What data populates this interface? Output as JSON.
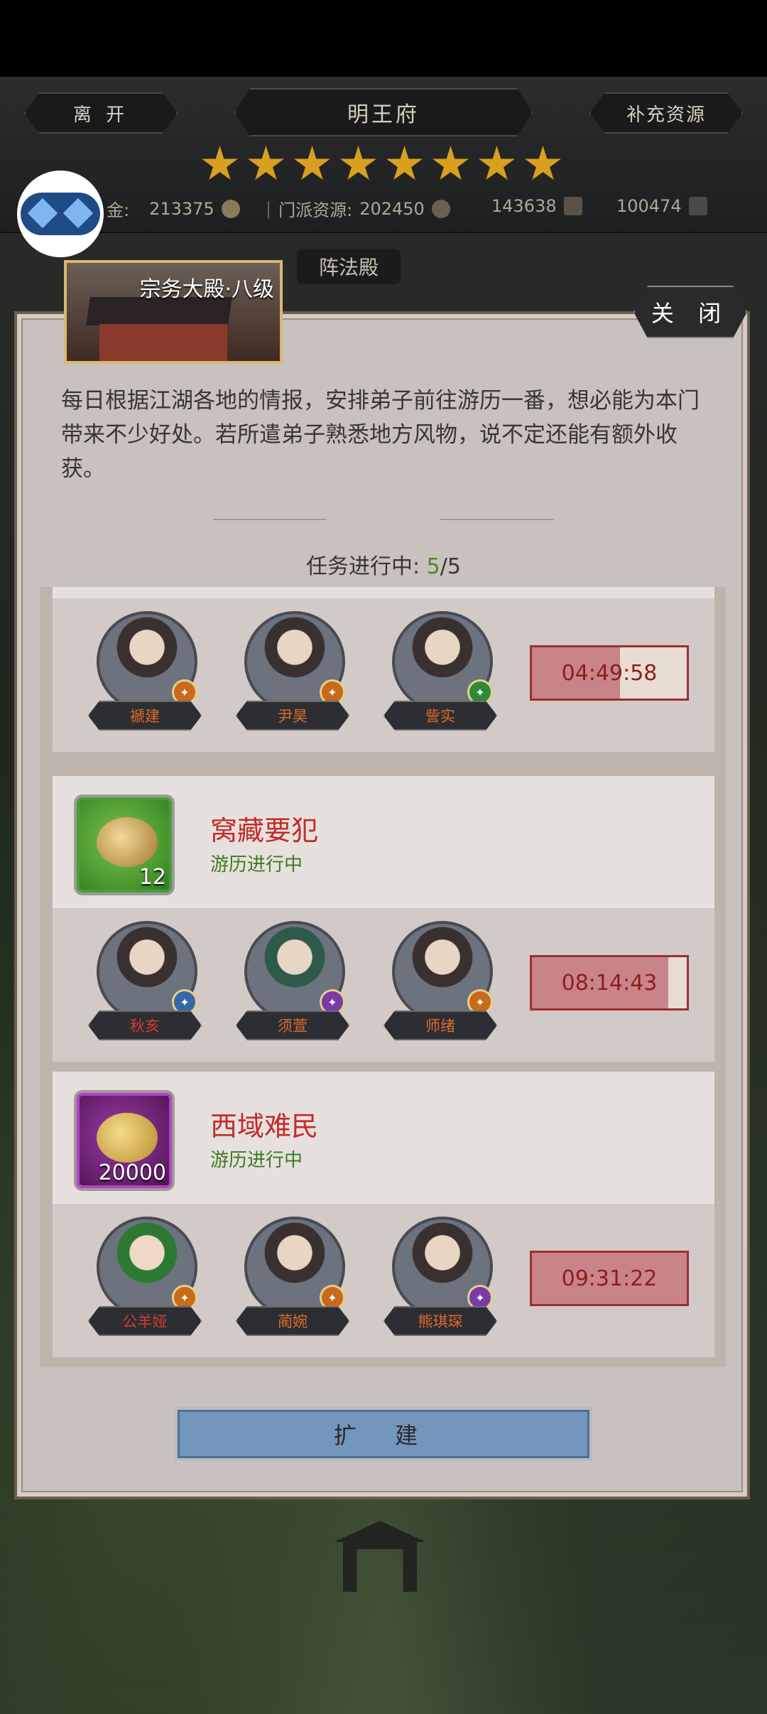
{
  "top_bar": {
    "leave_label": "离 开",
    "location_title": "明王府",
    "supply_label": "补充资源",
    "star_count": 8
  },
  "resources": {
    "gold_label": "金:",
    "gold_value": "213375",
    "sect_label": "门派资源:",
    "sect_value": "202450",
    "res3_value": "143638",
    "res4_value": "100474"
  },
  "tab": {
    "label": "阵法殿"
  },
  "panel": {
    "building_title": "宗务大殿·八级",
    "close_label": "关 闭",
    "description": "每日根据江湖各地的情报，安排弟子前往游历一番，想必能为本门带来不少好处。若所遣弟子熟悉地方风物，说不定还能有额外收获。",
    "progress_label": "任务进行中:",
    "progress_current": "5",
    "progress_separator": "/",
    "progress_total": "5",
    "expand_label": "扩 建"
  },
  "tasks": [
    {
      "heroes": [
        {
          "name": "褫建",
          "badge": "orange"
        },
        {
          "name": "尹昊",
          "badge": "orange"
        },
        {
          "name": "訾实",
          "badge": "green"
        }
      ],
      "timer": "04:49:58",
      "timer_progress": 0.57
    },
    {
      "reward_count": "12",
      "reward_icon": "gold-ingots-icon",
      "name": "窝藏要犯",
      "status": "游历进行中",
      "heroes": [
        {
          "name": "秋亥",
          "badge": "blue"
        },
        {
          "name": "须萱",
          "badge": "purple"
        },
        {
          "name": "师绪",
          "badge": "orange"
        }
      ],
      "timer": "08:14:43",
      "timer_progress": 0.88
    },
    {
      "reward_count": "20000",
      "reward_icon": "copper-coin-icon",
      "name": "西域难民",
      "status": "游历进行中",
      "heroes": [
        {
          "name": "公羊娅",
          "badge": "orange"
        },
        {
          "name": "蔺婉",
          "badge": "orange"
        },
        {
          "name": "熊琪琛",
          "badge": "purple"
        }
      ],
      "timer": "09:31:22",
      "timer_progress": 1.0
    }
  ]
}
